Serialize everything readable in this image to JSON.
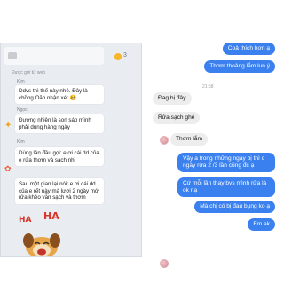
{
  "left_chat": {
    "counter": "3",
    "sent_label": "Được gửi từ web",
    "messages": [
      {
        "sender": "Kim",
        "text": "Ddvs thì thế này nhé. Đây là chồng Oăn nhận xét 😆"
      },
      {
        "sender": "Ngọc",
        "text": "Đương nhiên là son sáp mình phải dùng hàng ngày"
      },
      {
        "sender": "Kim",
        "text": "Dùng lần đầu gọi: e ơi cái dd của e rửa thơm và sạch nhỉ"
      },
      {
        "sender": "",
        "text": "Sau một gian lại nói: e ơi cái dd của e rết này mà lười 2 ngày mới rửa khéo vẫn sạch và thơm"
      }
    ],
    "sticker_text": "HA"
  },
  "right_chat": {
    "outgoing_top": [
      "Coả thích hơn ạ",
      "Thơm thoảng lắm lun ý"
    ],
    "time": "21:58",
    "incoming": [
      "Đag bị đây",
      "Rửa sạch ghê",
      "Thơm lắm"
    ],
    "outgoing_bottom": [
      "Vậy a trong những ngày bị thì c ngày rửa 2 /3 lần cũng đc ạ",
      "Cứ mỗi lần thay bvs mình rửa là ok nạ",
      "Mà chị có bị đau bụng ko ạ",
      "Em ak"
    ],
    "bottom_partial": "...",
    "colors": {
      "outgoing": "#3a80ee",
      "incoming": "#ededed"
    }
  }
}
